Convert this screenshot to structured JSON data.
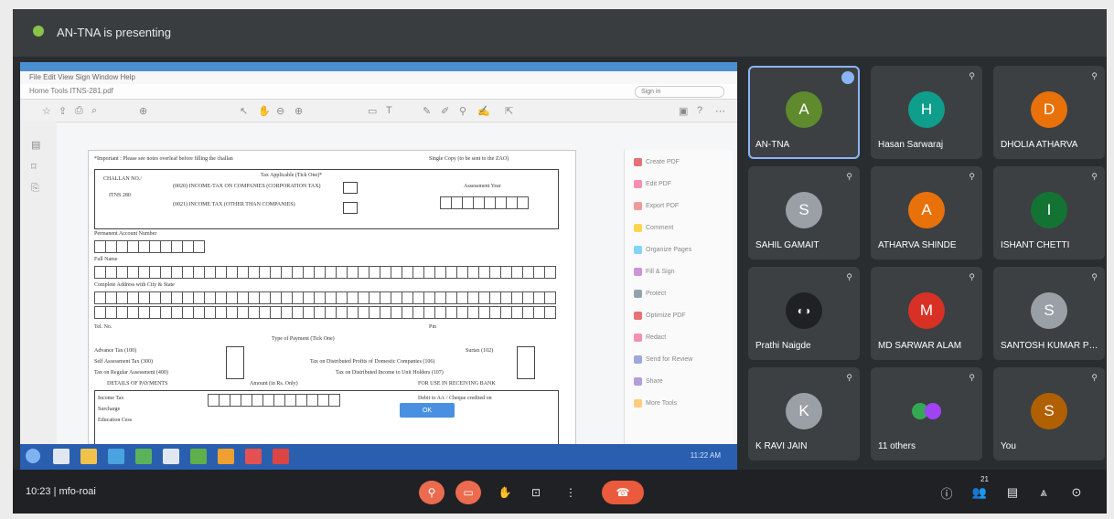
{
  "presenter_banner": "AN-TNA is presenting",
  "shared_window": {
    "menu": "File  Edit  View  Sign  Window  Help",
    "address": "Home  Tools      ITNS-281.pdf",
    "search_placeholder": "Sign in",
    "document": {
      "header_left": "*Important : Please see notes overleaf before filling the challan",
      "header_right": "Single Copy (to be sent to the ZAO)",
      "challan_no_label": "CHALLAN NO./",
      "itns": "ITNS 280",
      "applicable_label": "Tax Applicable (Tick One)*",
      "option1": "(0020) INCOME-TAX ON COMPANIES (CORPORATION TAX)",
      "option2": "(0021) INCOME TAX (OTHER THAN COMPANIES)",
      "assessment_year_label": "Assessment Year",
      "pan_label": "Permanent Account Number",
      "full_name_label": "Full Name",
      "address_label": "Complete Address with City & State",
      "tel_label": "Tel. No.",
      "pin_label": "Pin",
      "type_of_payment_label": "Type of Payment (Tick One)",
      "advance_tax": "Advance Tax (100)",
      "surtax": "Surtax (102)",
      "self_assessment": "Self Assessment Tax (300)",
      "tax_on_distributed_profits": "Tax on Distributed Profits of Domestic Companies (106)",
      "tax_on_regular": "Tax on Regular Assessment (400)",
      "tax_on_distributed_income": "Tax on Distributed Income to Unit Holders (107)",
      "details_of_payments": "DETAILS OF PAYMENTS",
      "amount_label": "Amount (in Rs. Only)",
      "for_use_in_bank": "FOR USE IN RECEIVING BANK",
      "income_tax_row": "Income Tax",
      "surcharge_row": "Surcharge",
      "debit_row": "Debit to A/c / Cheque credited on",
      "education_cess_row": "Education Cess",
      "dialog_button": "OK"
    },
    "side_panel": [
      "Create PDF",
      "Edit PDF",
      "Export PDF",
      "Comment",
      "Organize Pages",
      "Fill & Sign",
      "Protect",
      "Optimize PDF",
      "Redact",
      "Send for Review",
      "Share",
      "More Tools"
    ],
    "taskbar_clock": "11:22 AM"
  },
  "participants": [
    {
      "name": "AN-TNA",
      "initial": "A",
      "color": "#5f8a2d",
      "active": true
    },
    {
      "name": "Hasan Sarwaraj",
      "initial": "H",
      "color": "#0f9d8c"
    },
    {
      "name": "DHOLIA ATHARVA",
      "initial": "D",
      "color": "#e8710a"
    },
    {
      "name": "SAHIL GAMAIT",
      "initial": "S",
      "color": "#9aa0a6"
    },
    {
      "name": "ATHARVA SHINDE",
      "initial": "A",
      "color": "#e8710a"
    },
    {
      "name": "ISHANT CHETTI",
      "initial": "I",
      "color": "#137333"
    },
    {
      "name": "Prathi Naigde",
      "initial": "",
      "color": "#202124"
    },
    {
      "name": "MD SARWAR ALAM",
      "initial": "M",
      "color": "#d93025"
    },
    {
      "name": "SANTOSH KUMAR PR...",
      "initial": "S",
      "color": "#9aa0a6"
    },
    {
      "name": "K RAVI JAIN",
      "initial": "K",
      "color": "#9aa0a6"
    },
    {
      "name": "11 others",
      "initial": "",
      "color": "#3c4043"
    },
    {
      "name": "You",
      "initial": "S",
      "color": "#b06000"
    }
  ],
  "bottom": {
    "meeting_info": "10:23 | mfo-roai",
    "others_count": "21"
  },
  "colors": {
    "accent": "#8ab4f8",
    "danger": "#ea5a3c"
  }
}
